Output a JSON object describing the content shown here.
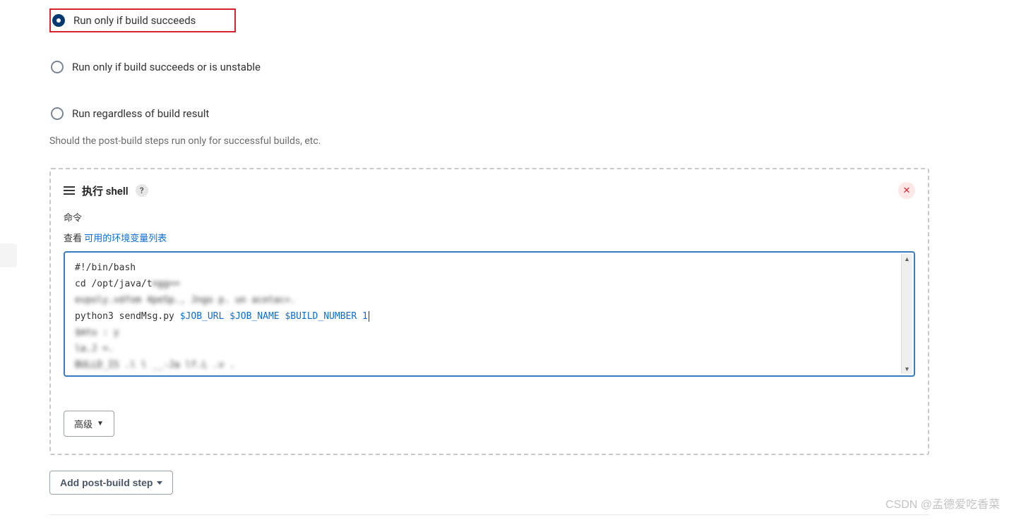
{
  "radios": {
    "option1": "Run only if build succeeds",
    "option2": "Run only if build succeeds or is unstable",
    "option3": "Run regardless of build result",
    "selected": "option1"
  },
  "helpText": "Should the post-build steps run only for successful builds, etc.",
  "shellStep": {
    "title": "执行 shell",
    "helpBadge": "?",
    "commandLabel": "命令",
    "envPrefix": "查看 ",
    "envLinkText": "可用的环境变量列表",
    "code": {
      "line1": "#!/bin/bash",
      "line2a": "cd /opt/java/t",
      "line2b": "ngg==",
      "line3": "evpoly.vdfom 4peSp., Jngo p. un acetac+.",
      "line4a": "python3 sendMsg.py ",
      "line4b": "$JOB_URL $JOB_NAME $BUILD_NUMBER 1",
      "line5": "$mtu : y",
      "line6": "la.J =.",
      "line7": "BULLD_IS .l l __-Ja lf.L .v ."
    },
    "advancedLabel": "高级"
  },
  "addStepLabel": "Add post-build step",
  "watermark": "CSDN @孟德爱吃香菜"
}
